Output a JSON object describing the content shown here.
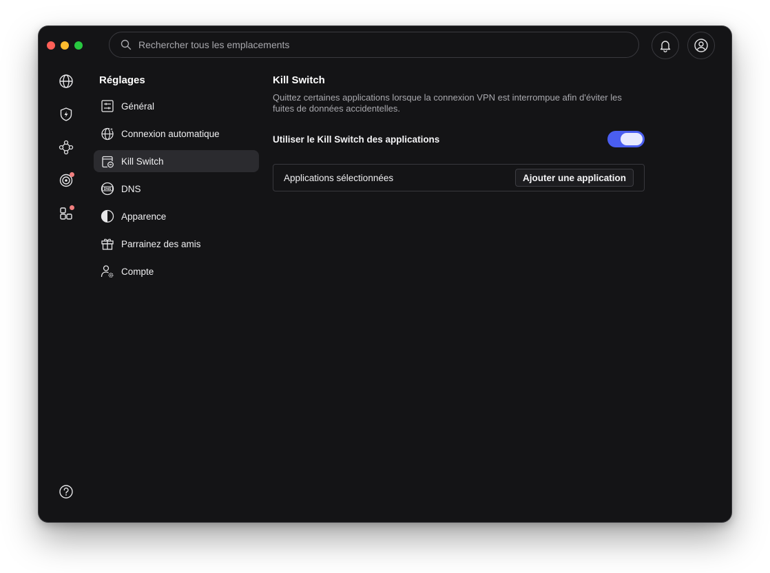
{
  "search": {
    "placeholder": "Rechercher tous les emplacements"
  },
  "sidebar": {
    "title": "Réglages",
    "items": [
      {
        "label": "Général",
        "icon": "sliders-icon"
      },
      {
        "label": "Connexion automatique",
        "icon": "globe-sparkle-icon"
      },
      {
        "label": "Kill Switch",
        "icon": "kill-switch-icon",
        "active": true
      },
      {
        "label": "DNS",
        "icon": "dns-icon"
      },
      {
        "label": "Apparence",
        "icon": "contrast-icon"
      },
      {
        "label": "Parrainez des amis",
        "icon": "gift-icon"
      },
      {
        "label": "Compte",
        "icon": "user-gear-icon"
      }
    ]
  },
  "rail": {
    "items": [
      "globe-icon",
      "shield-bolt-icon",
      "mesh-network-icon",
      "target-icon",
      "apps-grid-icon"
    ],
    "notifications": {
      "target-icon": true,
      "apps-grid-icon": true
    }
  },
  "main": {
    "title": "Kill Switch",
    "description": "Quittez certaines applications lorsque la connexion VPN est interrompue afin d'éviter les fuites de données accidentelles.",
    "toggle_label": "Utiliser le Kill Switch des applications",
    "toggle_on": true,
    "apps_label": "Applications sélectionnées",
    "add_button": "Ajouter une application"
  },
  "colors": {
    "background": "#141416",
    "accent": "#4a5ef0",
    "notification_dot": "#f07f7f",
    "active_item": "#2b2b2f"
  }
}
